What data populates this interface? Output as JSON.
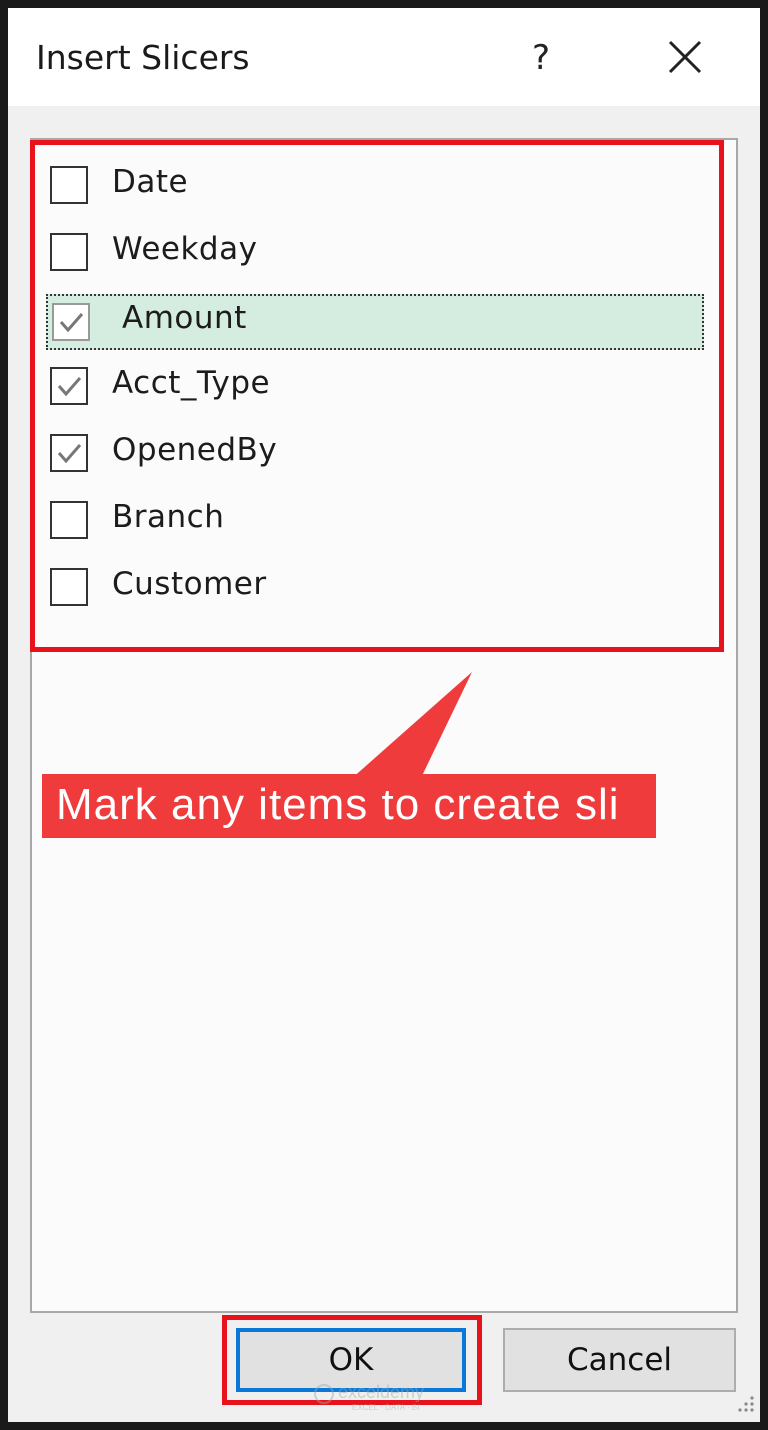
{
  "dialog": {
    "title": "Insert Slicers",
    "help_label": "?",
    "close_icon": "close-icon"
  },
  "fields": [
    {
      "label": "Date",
      "checked": false,
      "selected": false
    },
    {
      "label": "Weekday",
      "checked": false,
      "selected": false
    },
    {
      "label": "Amount",
      "checked": true,
      "selected": true
    },
    {
      "label": "Acct_Type",
      "checked": true,
      "selected": false
    },
    {
      "label": "OpenedBy",
      "checked": true,
      "selected": false
    },
    {
      "label": "Branch",
      "checked": false,
      "selected": false
    },
    {
      "label": "Customer",
      "checked": false,
      "selected": false
    }
  ],
  "annotation": {
    "text": "Mark any items to create sli",
    "color": "#ef3b3b",
    "highlight_color": "#e8121c"
  },
  "buttons": {
    "ok_label": "OK",
    "cancel_label": "Cancel"
  },
  "watermark": {
    "brand": "exceldemy",
    "tagline": "EXCEL · DATA · BI"
  },
  "colors": {
    "selection": "#d5ede0",
    "focus_border": "#0a78d7"
  }
}
